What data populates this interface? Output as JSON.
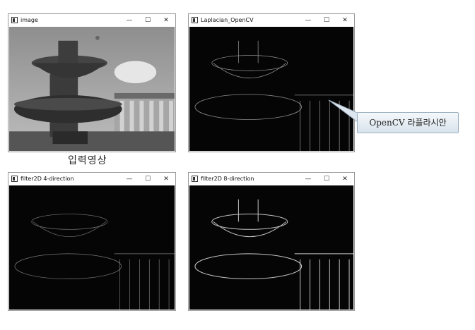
{
  "windows": [
    {
      "title": "image",
      "min": "—",
      "max": "☐",
      "close": "✕"
    },
    {
      "title": "Laplacian_OpenCV",
      "min": "—",
      "max": "☐",
      "close": "✕"
    },
    {
      "title": "filter2D 4-direction",
      "min": "—",
      "max": "☐",
      "close": "✕"
    },
    {
      "title": "filter2D 8-direction",
      "min": "—",
      "max": "☐",
      "close": "✕"
    }
  ],
  "caption": "입력영상",
  "callout": "OpenCV 라플라시안",
  "colors": {
    "edge_black": "#050505",
    "callout_border": "#9fb1c2"
  }
}
